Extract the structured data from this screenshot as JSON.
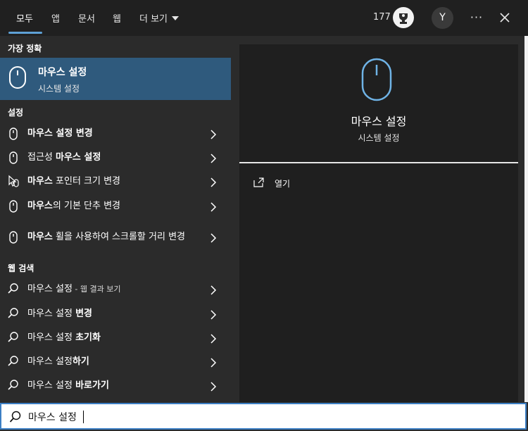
{
  "tabs": [
    {
      "label": "모두",
      "active": true
    },
    {
      "label": "앱"
    },
    {
      "label": "문서"
    },
    {
      "label": "웹"
    },
    {
      "label": "더 보기"
    }
  ],
  "header": {
    "points": "177",
    "avatar_letter": "Y",
    "more_icon": "ellipsis-icon",
    "close_icon": "close-icon"
  },
  "best_match": {
    "heading": "가장 정확",
    "title": "마우스 설정",
    "subtitle": "시스템 설정",
    "icon": "mouse-icon"
  },
  "settings": {
    "heading": "설정",
    "items": [
      {
        "parts": [
          {
            "t": "마우스 설정 변경",
            "b": true
          }
        ],
        "icon": "mouse-icon"
      },
      {
        "parts": [
          {
            "t": "접근성 ",
            "b": false
          },
          {
            "t": "마우스 설정",
            "b": true
          }
        ],
        "icon": "mouse-icon"
      },
      {
        "parts": [
          {
            "t": "마우스",
            "b": true
          },
          {
            "t": " 포인터 크기 변경",
            "b": false
          }
        ],
        "icon": "pointer-icon"
      },
      {
        "parts": [
          {
            "t": "마우스",
            "b": true
          },
          {
            "t": "의 기본 단추 변경",
            "b": false
          }
        ],
        "icon": "mouse-icon"
      },
      {
        "parts": [
          {
            "t": "마우스",
            "b": true
          },
          {
            "t": " 휠을 사용하여 스크롤할 거리 변경",
            "b": false
          }
        ],
        "icon": "mouse-icon"
      }
    ]
  },
  "web": {
    "heading": "웹 검색",
    "items": [
      {
        "parts": [
          {
            "t": "마우스 설정",
            "b": false
          },
          {
            "t": " - 웹 결과 보기",
            "b": false,
            "small": true
          }
        ]
      },
      {
        "parts": [
          {
            "t": "마우스 설정 ",
            "b": false
          },
          {
            "t": "변경",
            "b": true
          }
        ]
      },
      {
        "parts": [
          {
            "t": "마우스 설정 ",
            "b": false
          },
          {
            "t": "초기화",
            "b": true
          }
        ]
      },
      {
        "parts": [
          {
            "t": "마우스 설정",
            "b": false
          },
          {
            "t": "하기",
            "b": true
          }
        ]
      },
      {
        "parts": [
          {
            "t": "마우스 설정 ",
            "b": false
          },
          {
            "t": "바로가기",
            "b": true
          }
        ]
      }
    ]
  },
  "preview": {
    "title": "마우스 설정",
    "subtitle": "시스템 설정",
    "action_label": "열기",
    "action_icon": "open-icon"
  },
  "search": {
    "value": "마우스 설정",
    "icon": "search-icon"
  },
  "colors": {
    "accent": "#5ea1d6",
    "selected": "#2f5a7d",
    "panel": "#2b2b2b",
    "preview_bg": "#1f1f1f",
    "search_border": "#3c7fc4"
  }
}
